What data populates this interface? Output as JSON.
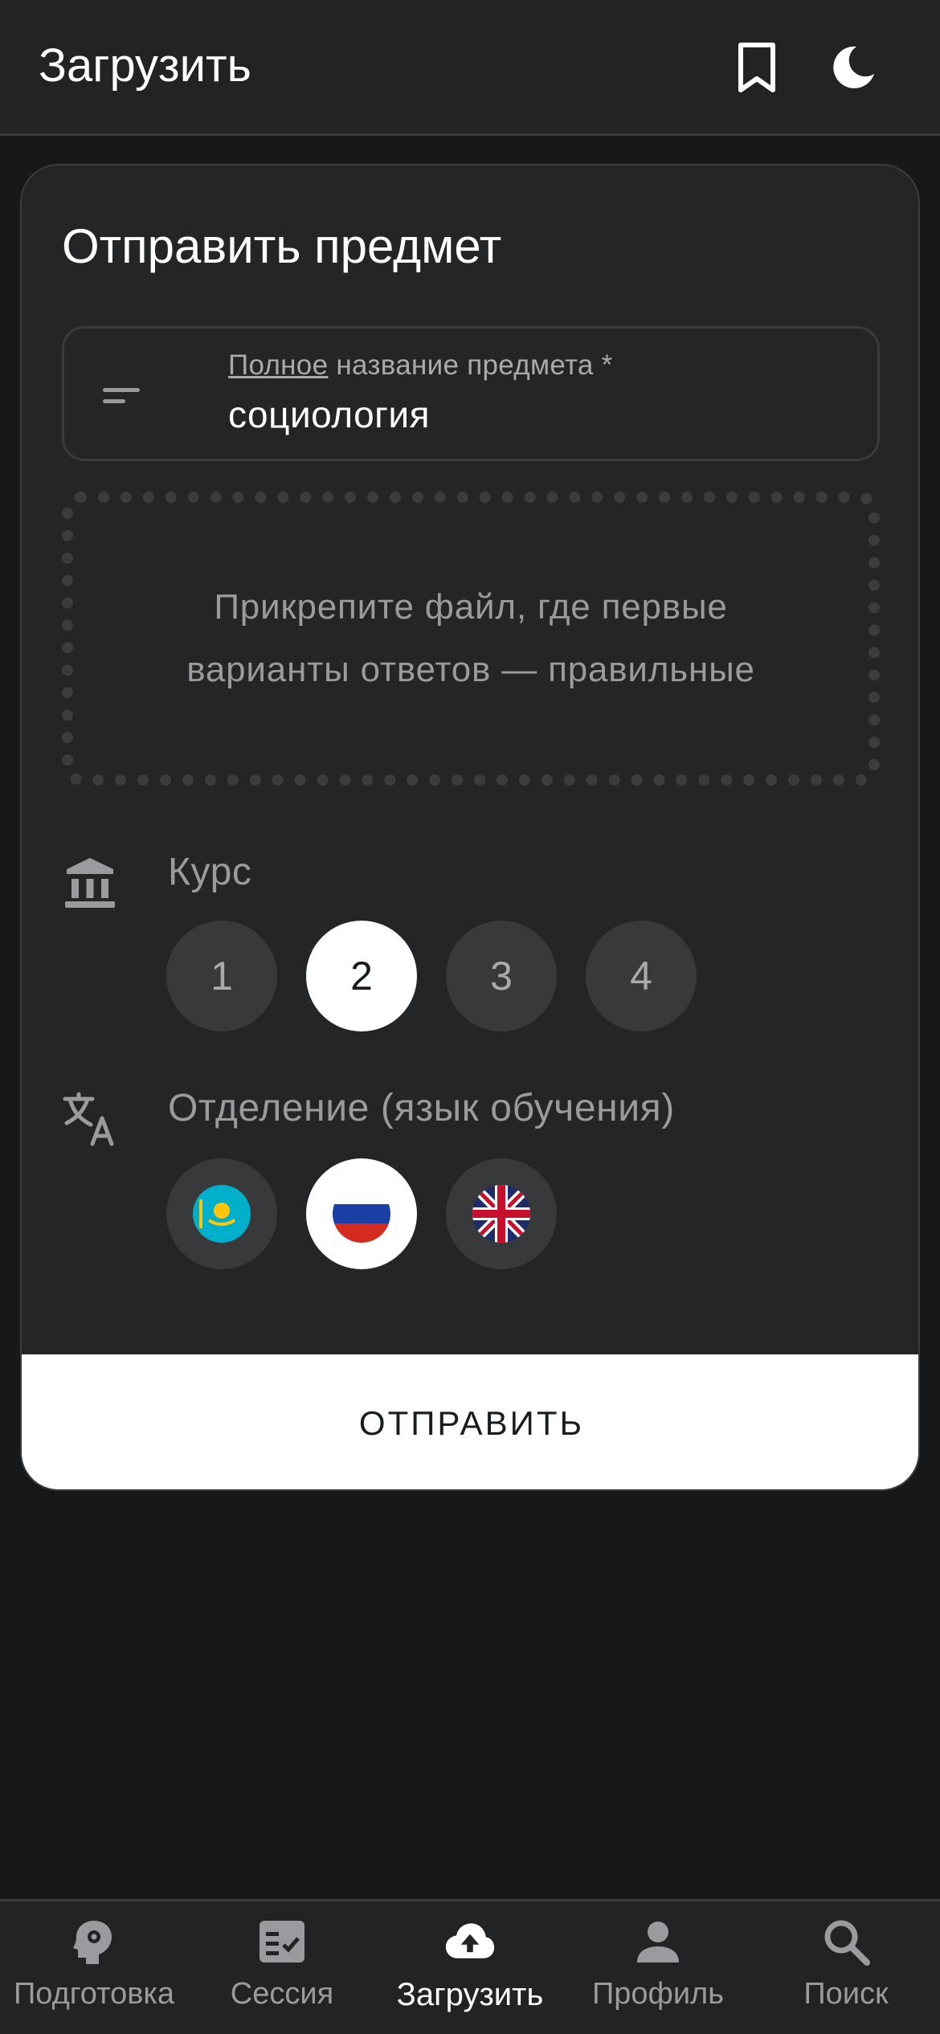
{
  "appbar": {
    "title": "Загрузить",
    "icons": [
      "bookmark-icon",
      "moon-icon"
    ]
  },
  "card": {
    "title": "Отправить предмет",
    "subject_field": {
      "label_underlined": "Полное",
      "label_rest": " название предмета *",
      "value": "социология",
      "icon": "short-text-icon"
    },
    "dropzone": {
      "line1": "Прикрепите файл, где первые",
      "line2": "варианты ответов — правильные"
    },
    "course": {
      "label": "Курс",
      "icon": "bank-icon",
      "options": [
        "1",
        "2",
        "3",
        "4"
      ],
      "selected": "2"
    },
    "department": {
      "label": "Отделение (язык обучения)",
      "icon": "translate-icon",
      "options": [
        "kazakhstan-flag-icon",
        "russia-flag-icon",
        "uk-flag-icon"
      ],
      "selected": "russia-flag-icon"
    },
    "submit_label": "ОТПРАВИТЬ"
  },
  "bottom_nav": {
    "items": [
      {
        "label": "Подготовка",
        "icon": "brain-gear-icon",
        "active": false
      },
      {
        "label": "Сессия",
        "icon": "checklist-icon",
        "active": false
      },
      {
        "label": "Загрузить",
        "icon": "cloud-upload-icon",
        "active": true
      },
      {
        "label": "Профиль",
        "icon": "person-icon",
        "active": false
      },
      {
        "label": "Поиск",
        "icon": "search-icon",
        "active": false
      }
    ]
  },
  "colors": {
    "background": "#17181a",
    "surface": "#242527",
    "appbar": "#222325",
    "chip": "#38393b",
    "selected": "#ffffff",
    "muted_text": "#9a9b9e"
  }
}
